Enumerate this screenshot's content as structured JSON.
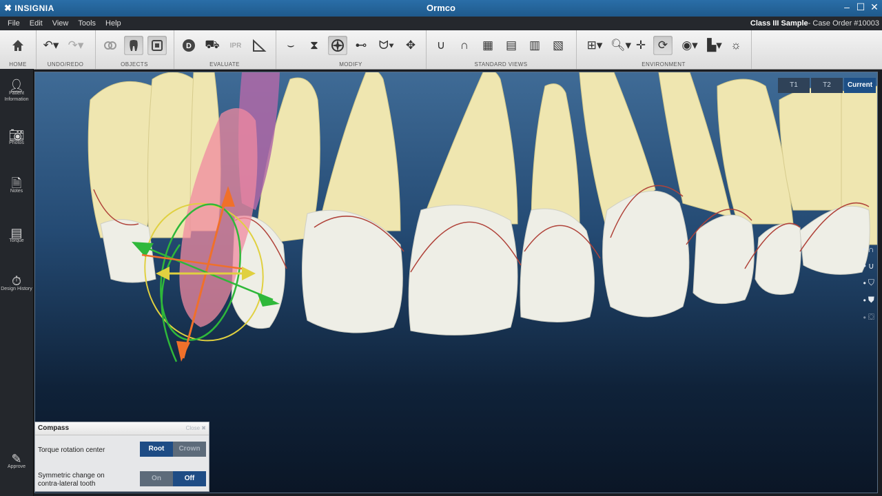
{
  "window": {
    "brand": "INSIGNIA",
    "title": "Ormco",
    "controls": [
      "–",
      "☐",
      "✕"
    ]
  },
  "menu": {
    "items": [
      "File",
      "Edit",
      "View",
      "Tools",
      "Help"
    ],
    "case_name": "Class III Sample",
    "case_order": "- Case Order #10003"
  },
  "toolbar": {
    "groups": [
      "HOME",
      "UNDO/REDO",
      "OBJECTS",
      "EVALUATE",
      "MODIFY",
      "STANDARD VIEWS",
      "ENVIRONMENT"
    ],
    "evaluate_d": "D",
    "evaluate_ipr": "IPR"
  },
  "sidebar": {
    "items": [
      "Patient Information",
      "Photos",
      "Notes",
      "Torque",
      "Design History",
      "Approve"
    ]
  },
  "viewport": {
    "tabs": [
      "T1",
      "T2",
      "Current"
    ],
    "selected_tab": "Current"
  },
  "compass": {
    "title": "Compass",
    "close_label": "Close",
    "torque_label": "Torque rotation center",
    "torque_options": [
      "Root",
      "Crown"
    ],
    "torque_selected": "Root",
    "symmetric_label_1": "Symmetric change on",
    "symmetric_label_2": "contra-lateral tooth",
    "symmetric_options": [
      "On",
      "Off"
    ],
    "symmetric_selected": "Off"
  },
  "colors": {
    "accent": "#1e4c85",
    "titlebar": "#1f5a8c",
    "tooth_root": "#efe6b0",
    "tooth_crown": "#eeeee6",
    "gum_line": "#b0433a"
  }
}
